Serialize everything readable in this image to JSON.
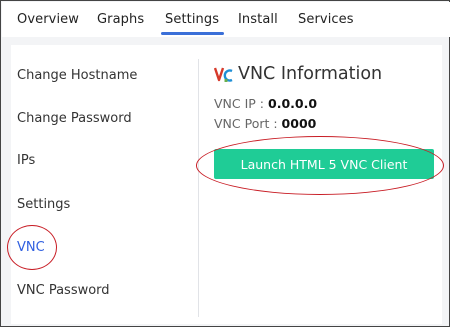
{
  "tabs": [
    {
      "label": "Overview",
      "active": false
    },
    {
      "label": "Graphs",
      "active": false
    },
    {
      "label": "Settings",
      "active": true
    },
    {
      "label": "Install",
      "active": false
    },
    {
      "label": "Services",
      "active": false
    }
  ],
  "sidebar": {
    "items": [
      {
        "label": "Change Hostname",
        "active": false
      },
      {
        "label": "Change Password",
        "active": false
      },
      {
        "label": "IPs",
        "active": false
      },
      {
        "label": "Settings",
        "active": false
      },
      {
        "label": "VNC",
        "active": true
      },
      {
        "label": "VNC Password",
        "active": false
      }
    ]
  },
  "vnc": {
    "title": "VNC Information",
    "logo_icon": "vnc-logo-icon",
    "ip_label": "VNC IP : ",
    "ip_value": "0.0.0.0",
    "port_label": "VNC Port : ",
    "port_value": "0000",
    "launch_label": "Launch HTML 5 VNC Client"
  },
  "colors": {
    "accent": "#3a6fd8",
    "active_link": "#2f5fe0",
    "button": "#1fcc96",
    "annotation": "#c81d25"
  }
}
